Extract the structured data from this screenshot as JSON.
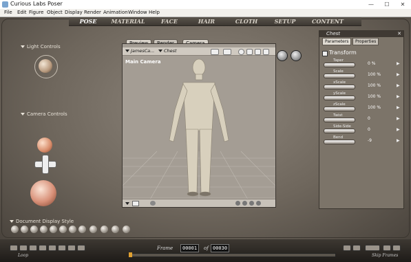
{
  "window": {
    "title": "Curious Labs Poser",
    "minimize": "—",
    "maximize": "☐",
    "close": "✕"
  },
  "menu": [
    "File",
    "Edit",
    "Figure",
    "Object",
    "Display",
    "Render",
    "Animation",
    "Window",
    "Help"
  ],
  "rooms": [
    "POSE",
    "MATERIAL",
    "FACE",
    "HAIR",
    "CLOTH",
    "SETUP",
    "CONTENT"
  ],
  "left": {
    "light_controls": "Light Controls",
    "camera_controls": "Camera Controls",
    "document_display_style": "Document Display Style"
  },
  "preview": {
    "tabs": [
      "Preview",
      "Render"
    ],
    "camera_label_tab": "Camera MoveXY",
    "figure_select": "JamesCa...",
    "part_select": "Chest",
    "camera_name": "Main Camera"
  },
  "panel": {
    "title": "Chest",
    "tabs": [
      "Parameters",
      "Properties"
    ],
    "section": "Transform",
    "params": [
      {
        "name": "Taper",
        "value": "0 %"
      },
      {
        "name": "Scale",
        "value": "100 %"
      },
      {
        "name": "xScale",
        "value": "100 %"
      },
      {
        "name": "yScale",
        "value": "100 %"
      },
      {
        "name": "zScale",
        "value": "100 %"
      },
      {
        "name": "Twist",
        "value": "0"
      },
      {
        "name": "Side-Side",
        "value": "0"
      },
      {
        "name": "Bend",
        "value": "-9"
      }
    ]
  },
  "timeline": {
    "frame_label": "Frame",
    "current_frame": "00001",
    "of_label": "of",
    "total_frames": "00030",
    "loop_label": "Loop",
    "skip_frames_label": "Skip Frames"
  }
}
